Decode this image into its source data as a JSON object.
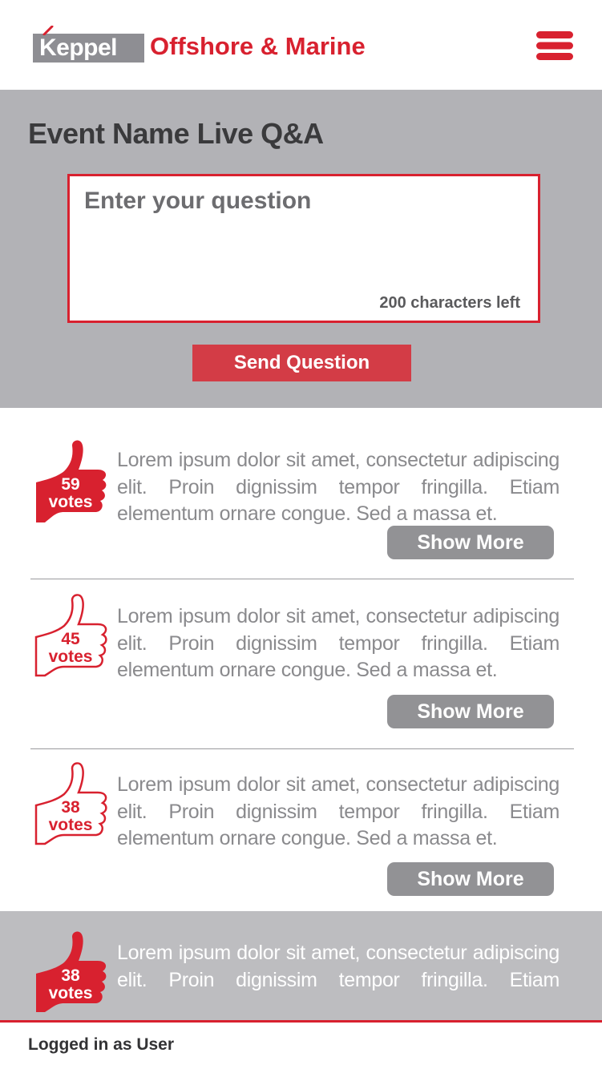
{
  "header": {
    "logo_text": "Keppel",
    "brand_text": "Offshore & Marine",
    "brand_color": "#d8212f",
    "menu_icon": "hamburger-menu-icon"
  },
  "form": {
    "title": "Event Name Live Q&A",
    "placeholder": "Enter your question",
    "chars_left": "200 characters left",
    "send_label": "Send Question"
  },
  "questions": [
    {
      "votes": "59",
      "votes_label": "votes",
      "text": "Lorem ipsum dolor sit amet, consectetur adipiscing elit. Proin dignissim tempor fringilla. Etiam elementum ornare congue. Sed a massa et.",
      "more_label": "Show More",
      "voted": true
    },
    {
      "votes": "45",
      "votes_label": "votes",
      "text": "Lorem ipsum dolor sit amet, consectetur adipiscing elit. Proin dignissim tempor fringilla. Etiam elementum ornare congue. Sed a massa et.",
      "more_label": "Show More",
      "voted": false
    },
    {
      "votes": "38",
      "votes_label": "votes",
      "text": "Lorem ipsum dolor sit amet, consectetur adipiscing elit. Proin dignissim tempor fringilla. Etiam elementum ornare congue. Sed a massa et.",
      "more_label": "Show More",
      "voted": false
    },
    {
      "votes": "38",
      "votes_label": "votes",
      "text": "Lorem ipsum dolor sit amet, consectetur adipiscing elit. Proin dignissim tempor fringilla. Etiam elementum",
      "voted": true
    }
  ],
  "footer": {
    "status": "Logged in as User"
  }
}
